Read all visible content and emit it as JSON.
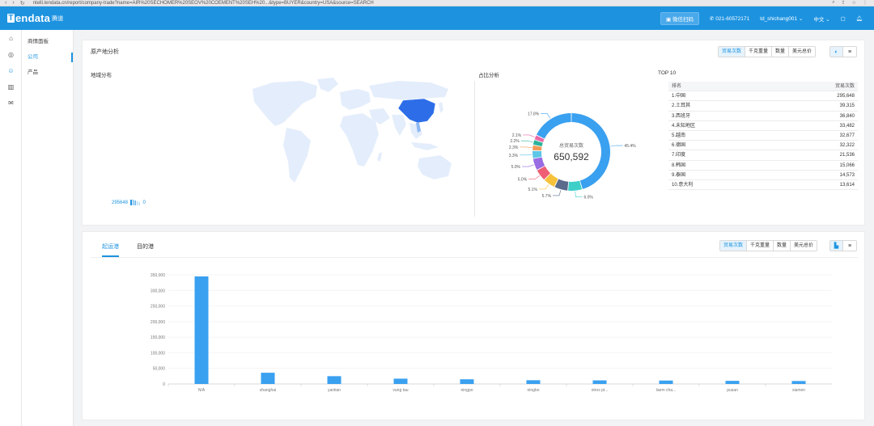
{
  "browser": {
    "nav_icons": [
      "back-icon",
      "forward-icon",
      "reload-icon"
    ],
    "url": "ntelli.tendata.cn/report/company-trade?name=AIR%20SECHOMER%20SEOV%20COEMENT%20SEH%20...&type=BUYER&country=USA&source=SEARCH"
  },
  "app": {
    "logo_text": "endata",
    "logo_letter": "T",
    "logo_cn": "腾道",
    "wechat_btn": "微信扫码",
    "phone": "021-60572171",
    "user": "td_shichang001",
    "lang": "中文",
    "accent": "#1d93e0"
  },
  "sidebar": {
    "icons": [
      "home-icon",
      "target-icon",
      "users-icon",
      "chart-icon",
      "mail-icon"
    ],
    "items": [
      {
        "label": "商情面板",
        "active": false
      },
      {
        "label": "公司",
        "active": true
      },
      {
        "label": "产品",
        "active": false
      }
    ]
  },
  "origin": {
    "title": "原产地分析",
    "buttons": [
      "贸易次数",
      "千克重量",
      "数量",
      "美元总价"
    ],
    "active_button": 0,
    "view_icons": [
      "donut-icon",
      "list-icon"
    ],
    "map_label": "地域分布",
    "map_legend_max": "295648",
    "map_legend_min": "0",
    "ratio_label": "占比分析",
    "donut_center_label": "总贸易次数",
    "donut_total": "650,592",
    "slices": [
      {
        "pct": 45.4,
        "label": "45.4%",
        "color": "#3aa0f0"
      },
      {
        "pct": 6.0,
        "label": "6.0%",
        "color": "#3ed0c8"
      },
      {
        "pct": 5.7,
        "label": "5.7%",
        "color": "#5a6b8c"
      },
      {
        "pct": 5.1,
        "label": "5.1%",
        "color": "#f7c23a"
      },
      {
        "pct": 5.0,
        "label": "5.0%",
        "color": "#ef5f74"
      },
      {
        "pct": 5.0,
        "label": "5.0%",
        "color": "#9a6ce3"
      },
      {
        "pct": 3.3,
        "label": "3.3%",
        "color": "#5ec6e6"
      },
      {
        "pct": 2.3,
        "label": "2.3%",
        "color": "#f29a56"
      },
      {
        "pct": 2.2,
        "label": "2.2%",
        "color": "#2bb39a"
      },
      {
        "pct": 2.1,
        "label": "2.1%",
        "color": "#e96aa8"
      },
      {
        "pct": 17.8,
        "label": "17.8%",
        "color": "#3aa0f0"
      }
    ],
    "top10_title": "TOP 10",
    "top10_head": [
      "排名",
      "贸易次数"
    ],
    "top10": [
      {
        "name": "1.中国",
        "value": "295,648"
      },
      {
        "name": "2.土耳其",
        "value": "39,315"
      },
      {
        "name": "3.西班牙",
        "value": "36,840"
      },
      {
        "name": "4.未知地区",
        "value": "33,482"
      },
      {
        "name": "5.越南",
        "value": "32,677"
      },
      {
        "name": "6.德国",
        "value": "32,322"
      },
      {
        "name": "7.印度",
        "value": "21,536"
      },
      {
        "name": "8.韩国",
        "value": "15,066"
      },
      {
        "name": "9.泰国",
        "value": "14,573"
      },
      {
        "name": "10.意大利",
        "value": "13,614"
      }
    ]
  },
  "ports": {
    "tabs": [
      "起运港",
      "目的港"
    ],
    "active_tab": 0,
    "buttons": [
      "贸易次数",
      "千克重量",
      "数量",
      "美元总价"
    ],
    "active_button": 0,
    "view_icons": [
      "bar-chart-icon",
      "list-icon"
    ]
  },
  "chart_data": {
    "type": "bar",
    "categories": [
      "N/A",
      "shanghai",
      "yantian",
      "vung tau",
      "ningpo",
      "ningbo",
      "otros pt...",
      "laem cha...",
      "pusan",
      "xiamen"
    ],
    "values": [
      345000,
      36000,
      25000,
      17000,
      15000,
      12000,
      11500,
      11000,
      10000,
      9500
    ],
    "ylim": [
      0,
      350000
    ],
    "yticks": [
      "0",
      "50,000",
      "100,000",
      "150,000",
      "200,000",
      "250,000",
      "300,000",
      "350,000"
    ],
    "color": "#3aa0f0",
    "grid": true
  }
}
